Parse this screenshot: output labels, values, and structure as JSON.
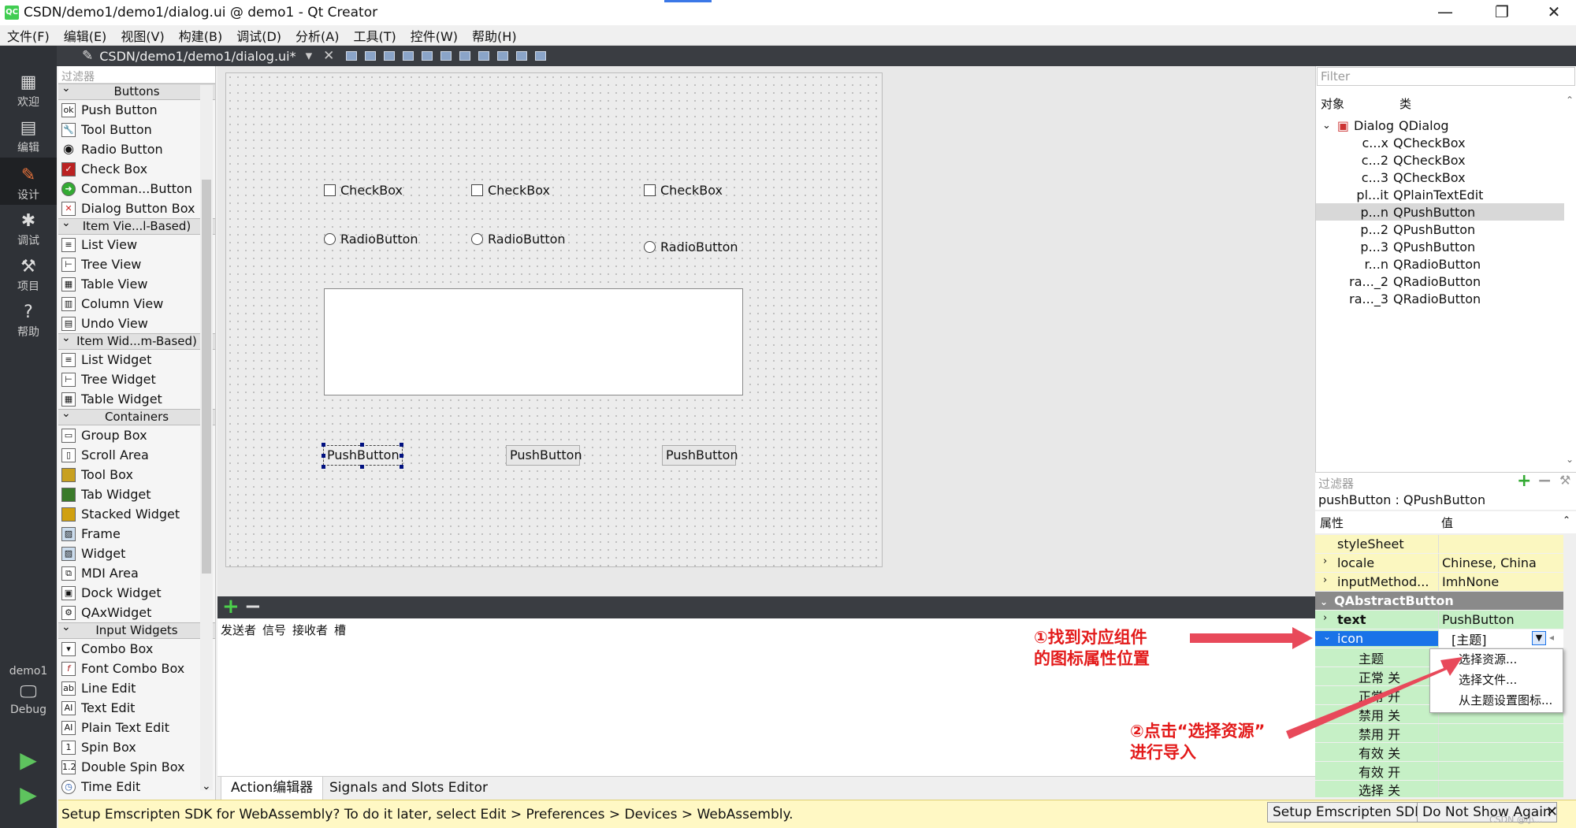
{
  "window": {
    "title": "CSDN/demo1/demo1/dialog.ui @ demo1 - Qt Creator",
    "app_icon": "QC",
    "min": "—",
    "max": "❐",
    "close": "✕"
  },
  "menu": [
    "文件(F)",
    "编辑(E)",
    "视图(V)",
    "构建(B)",
    "调试(D)",
    "分析(A)",
    "工具(T)",
    "控件(W)",
    "帮助(H)"
  ],
  "modes": [
    {
      "label": "欢迎",
      "icon": "grid-icon"
    },
    {
      "label": "编辑",
      "icon": "edit-icon"
    },
    {
      "label": "设计",
      "icon": "pencil-icon",
      "active": true
    },
    {
      "label": "调试",
      "icon": "bug-icon"
    },
    {
      "label": "项目",
      "icon": "wrench-icon"
    },
    {
      "label": "帮助",
      "icon": "help-icon"
    }
  ],
  "kit": {
    "project": "demo1",
    "config": "Debug"
  },
  "editor": {
    "document": "CSDN/demo1/demo1/dialog.ui*"
  },
  "widgetbox": {
    "filter_placeholder": "过滤器",
    "sections": [
      {
        "title": "Buttons",
        "items": [
          "Push Button",
          "Tool Button",
          "Radio Button",
          "Check Box",
          "Comman...Button",
          "Dialog Button Box"
        ]
      },
      {
        "title": "Item Vie...l-Based)",
        "items": [
          "List View",
          "Tree View",
          "Table View",
          "Column View",
          "Undo View"
        ]
      },
      {
        "title": "Item Wid...m-Based)",
        "items": [
          "List Widget",
          "Tree Widget",
          "Table Widget"
        ]
      },
      {
        "title": "Containers",
        "items": [
          "Group Box",
          "Scroll Area",
          "Tool Box",
          "Tab Widget",
          "Stacked Widget",
          "Frame",
          "Widget",
          "MDI Area",
          "Dock Widget",
          "QAxWidget"
        ]
      },
      {
        "title": "Input Widgets",
        "items": [
          "Combo Box",
          "Font Combo Box",
          "Line Edit",
          "Text Edit",
          "Plain Text Edit",
          "Spin Box",
          "Double Spin Box",
          "Time Edit"
        ]
      }
    ]
  },
  "form": {
    "checkboxes": [
      "CheckBox",
      "CheckBox",
      "CheckBox"
    ],
    "radios": [
      "RadioButton",
      "RadioButton",
      "RadioButton"
    ],
    "buttons": [
      "PushButton",
      "PushButton",
      "PushButton"
    ]
  },
  "signals": {
    "headers": [
      "发送者",
      "信号",
      "接收者",
      "槽"
    ]
  },
  "bottom_tabs": [
    "Action编辑器",
    "Signals and Slots Editor"
  ],
  "notification": {
    "text": "Setup Emscripten SDK for WebAssembly? To do it later, select Edit > Preferences > Devices > WebAssembly.",
    "setup_button": "Setup Emscripten SDK",
    "dismiss_button": "Do Not Show Again",
    "watermark": "CSDN @小..."
  },
  "object_inspector": {
    "filter_placeholder": "Filter",
    "col_object": "对象",
    "col_class": "类",
    "root": {
      "name": "Dialog",
      "class": "QDialog"
    },
    "children": [
      {
        "name": "c...x",
        "class": "QCheckBox"
      },
      {
        "name": "c...2",
        "class": "QCheckBox"
      },
      {
        "name": "c...3",
        "class": "QCheckBox"
      },
      {
        "name": "pl...it",
        "class": "QPlainTextEdit"
      },
      {
        "name": "p...n",
        "class": "QPushButton",
        "selected": true
      },
      {
        "name": "p...2",
        "class": "QPushButton"
      },
      {
        "name": "p...3",
        "class": "QPushButton"
      },
      {
        "name": "r...n",
        "class": "QRadioButton"
      },
      {
        "name": "ra..._2",
        "class": "QRadioButton"
      },
      {
        "name": "ra..._3",
        "class": "QRadioButton"
      }
    ]
  },
  "property_editor": {
    "filter_placeholder": "过滤器",
    "class_label": "pushButton : QPushButton",
    "col_property": "属性",
    "col_value": "值",
    "rows": [
      {
        "name": "styleSheet",
        "value": "",
        "style": "y"
      },
      {
        "name": "locale",
        "value": "Chinese, China",
        "style": "y",
        "expandable": true
      },
      {
        "name": "inputMethod...",
        "value": "ImhNone",
        "style": "y",
        "expandable": true
      },
      {
        "name": "QAbstractButton",
        "value": "",
        "style": "gr",
        "group": true
      },
      {
        "name": "text",
        "value": "PushButton",
        "style": "g",
        "expandable": true,
        "bold": true
      },
      {
        "name": "icon",
        "value": "[主题]",
        "style": "g",
        "selected": true
      },
      {
        "name": "主题",
        "value": "",
        "style": "g",
        "sub": true
      },
      {
        "name": "正常 关",
        "value": "",
        "style": "g",
        "sub": true
      },
      {
        "name": "正常 开",
        "value": "",
        "style": "g",
        "sub": true
      },
      {
        "name": "禁用 关",
        "value": "",
        "style": "g",
        "sub": true
      },
      {
        "name": "禁用 开",
        "value": "",
        "style": "g",
        "sub": true
      },
      {
        "name": "有效 关",
        "value": "",
        "style": "g",
        "sub": true
      },
      {
        "name": "有效 开",
        "value": "",
        "style": "g",
        "sub": true
      },
      {
        "name": "选择 关",
        "value": "",
        "style": "g",
        "sub": true
      }
    ]
  },
  "context_menu": [
    "选择资源...",
    "选择文件...",
    "从主题设置图标..."
  ],
  "annotations": {
    "step1": [
      "①找到对应组件",
      "的图标属性位置"
    ],
    "step2": [
      "②点击“选择资源”",
      "进行导入"
    ]
  },
  "colors": {
    "accent_orange": "#e8733c",
    "annotation_red": "#e31a1a",
    "selection_blue": "#1a73e8"
  }
}
